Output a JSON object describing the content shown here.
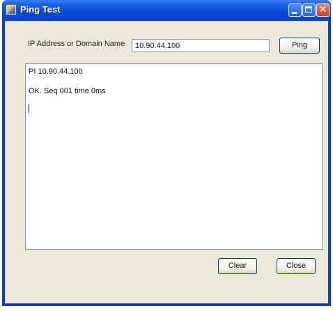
{
  "window": {
    "title": "Ping Test"
  },
  "form": {
    "ip_label": "IP Address or Domain Name",
    "ip_value": "10.90.44.100",
    "ping_label": "Ping"
  },
  "output": {
    "lines": [
      "PI 10.90.44.100",
      "OK. Seq 001 time 0ms"
    ]
  },
  "buttons": {
    "clear_label": "Clear",
    "close_label": "Close"
  },
  "colors": {
    "titlebar": "#0a49d7",
    "client": "#ece9d8"
  }
}
